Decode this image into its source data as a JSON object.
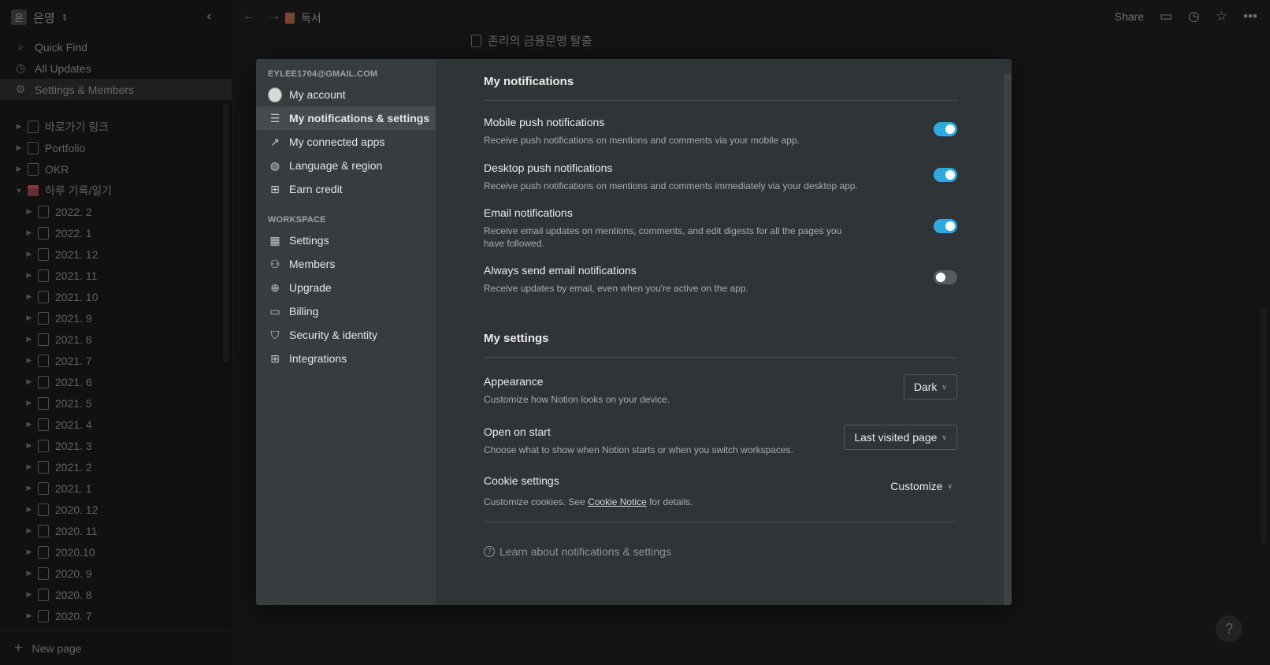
{
  "sidebar": {
    "workspace_initial": "은",
    "workspace_name": "은영",
    "nav": [
      {
        "label": "Quick Find",
        "icon": "search-icon"
      },
      {
        "label": "All Updates",
        "icon": "clock-icon"
      },
      {
        "label": "Settings & Members",
        "icon": "gear-icon"
      }
    ],
    "top_pages": [
      "바로가기 링크",
      "Portfolio",
      "OKR"
    ],
    "diary_page": "하루 기록/일기",
    "diary_children": [
      "2022. 2",
      "2022. 1",
      "2021. 12",
      "2021. 11",
      "2021. 10",
      "2021. 9",
      "2021. 8",
      "2021. 7",
      "2021. 6",
      "2021. 5",
      "2021. 4",
      "2021. 3",
      "2021. 2",
      "2021. 1",
      "2020. 12",
      "2020. 11",
      "2020.10",
      "2020. 9",
      "2020. 8",
      "2020. 7"
    ],
    "new_page_label": "New page"
  },
  "topbar": {
    "breadcrumb": "독서",
    "share_label": "Share"
  },
  "page": {
    "title": "존리의 금융문맹 탈출"
  },
  "modal": {
    "account_email": "EYLEE1704@GMAIL.COM",
    "account_items": [
      {
        "label": "My account",
        "icon": "avatar"
      },
      {
        "label": "My notifications & settings",
        "icon": "sliders-icon",
        "active": true
      },
      {
        "label": "My connected apps",
        "icon": "external-link-icon"
      },
      {
        "label": "Language & region",
        "icon": "globe-icon"
      },
      {
        "label": "Earn credit",
        "icon": "gift-icon"
      }
    ],
    "workspace_label": "WORKSPACE",
    "workspace_items": [
      {
        "label": "Settings",
        "icon": "building-icon"
      },
      {
        "label": "Members",
        "icon": "people-icon"
      },
      {
        "label": "Upgrade",
        "icon": "arrow-up-circle-icon"
      },
      {
        "label": "Billing",
        "icon": "credit-card-icon"
      },
      {
        "label": "Security & identity",
        "icon": "shield-icon"
      },
      {
        "label": "Integrations",
        "icon": "grid-icon"
      }
    ],
    "notifications": {
      "heading": "My notifications",
      "items": [
        {
          "title": "Mobile push notifications",
          "desc": "Receive push notifications on mentions and comments via your mobile app.",
          "on": true
        },
        {
          "title": "Desktop push notifications",
          "desc": "Receive push notifications on mentions and comments immediately via your desktop app.",
          "on": true
        },
        {
          "title": "Email notifications",
          "desc": "Receive email updates on mentions, comments, and edit digests for all the pages you have followed.",
          "on": true
        },
        {
          "title": "Always send email notifications",
          "desc": "Receive updates by email, even when you're active on the app.",
          "on": false
        }
      ]
    },
    "settings": {
      "heading": "My settings",
      "appearance": {
        "title": "Appearance",
        "desc": "Customize how Notion looks on your device.",
        "value": "Dark"
      },
      "open_on_start": {
        "title": "Open on start",
        "desc": "Choose what to show when Notion starts or when you switch workspaces.",
        "value": "Last visited page"
      },
      "cookie": {
        "title": "Cookie settings",
        "desc_prefix": "Customize cookies. See ",
        "link": "Cookie Notice",
        "desc_suffix": " for details.",
        "value": "Customize"
      }
    },
    "learn_link": "Learn about notifications & settings"
  },
  "colors": {
    "toggle_on": "#2eaadc",
    "modal_bg": "#2f3437",
    "modal_nav_bg": "#373c3f"
  }
}
